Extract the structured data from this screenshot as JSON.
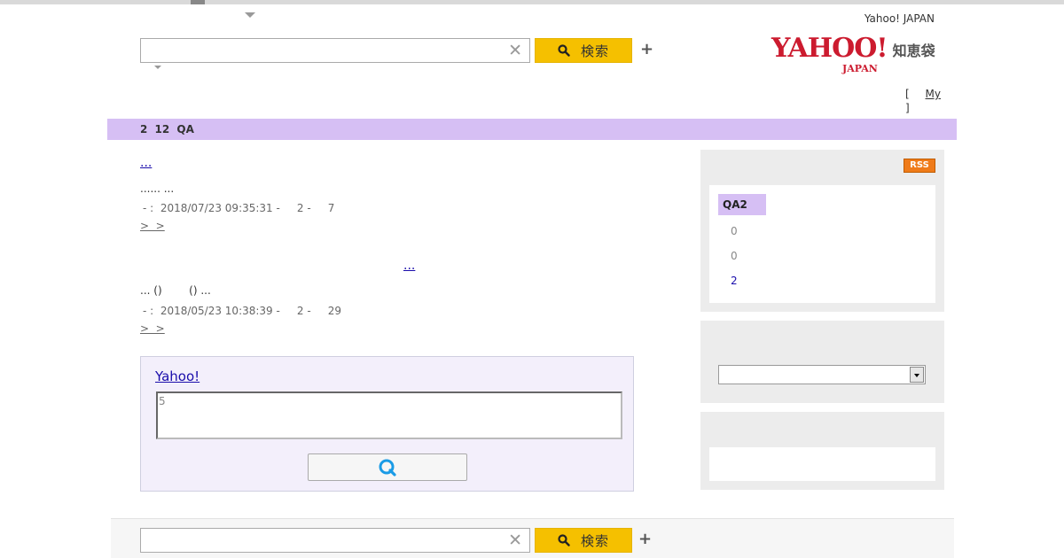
{
  "header": {
    "yahoo_japan_link": "Yahoo! JAPAN",
    "search": {
      "value": "",
      "placeholder": "",
      "clear_glyph": "✕",
      "button_label": "検索",
      "add_glyph": "+"
    },
    "logo": {
      "yahoo": "YAHOO!",
      "japan": "JAPAN",
      "service": "知恵袋"
    },
    "my_link": {
      "open": "[",
      "label": "My",
      "close": "]"
    }
  },
  "band": {
    "text": "2 12 QA"
  },
  "results": [
    {
      "title": "...",
      "snippet": "......   ...",
      "meta": "- :  2018/07/23 09:35:31 -     2 -     7",
      "more": ">  >"
    },
    {
      "title": "...",
      "snippet": "... ()        () ...",
      "meta": "- :  2018/05/23 10:38:39 -     2 -     29",
      "more": ">  >"
    }
  ],
  "ask": {
    "link": "Yahoo!",
    "textarea_value": "5",
    "button_icon": "question-search-icon",
    "button_glyph": "Q"
  },
  "sidebar": {
    "rss_label": "RSS",
    "qa_badge": "QA2",
    "stats": [
      "0",
      "0",
      "2"
    ],
    "select_value": ""
  },
  "footer": {
    "search": {
      "value": "",
      "clear_glyph": "✕",
      "button_label": "検索",
      "add_glyph": "+"
    }
  },
  "colors": {
    "accent_purple": "#d6bff4",
    "search_yellow": "#f5c000",
    "logo_red": "#cc1b2f",
    "link_blue": "#1a0dab",
    "rss_orange": "#ef7b1a",
    "ask_blue": "#1a9be6"
  }
}
